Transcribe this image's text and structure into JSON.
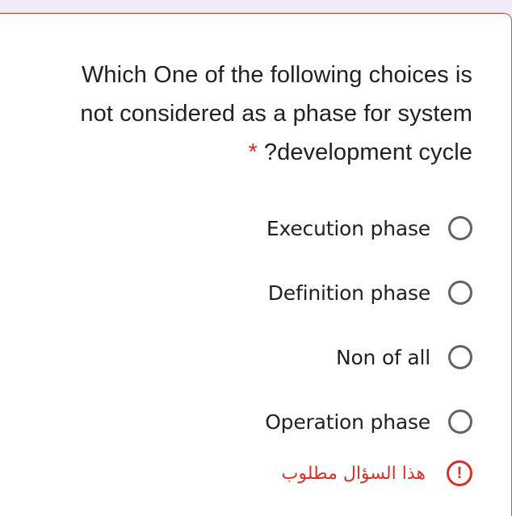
{
  "question": {
    "line1": "Which One of the following choices is",
    "line2": "not considered as a phase for system",
    "line3": "?development cycle",
    "required_marker": "*"
  },
  "options": [
    {
      "label": "Execution phase",
      "selected": false
    },
    {
      "label": "Definition phase",
      "selected": false
    },
    {
      "label": "Non of all",
      "selected": false
    },
    {
      "label": "Operation phase",
      "selected": false
    }
  ],
  "validation": {
    "message": "هذا السؤال مطلوب",
    "icon": "exclamation-circle-icon",
    "icon_glyph": "!"
  },
  "colors": {
    "accent_error": "#d93025",
    "radio_border": "#5f6368",
    "page_background": "#f0ebf8",
    "text": "#202124"
  }
}
